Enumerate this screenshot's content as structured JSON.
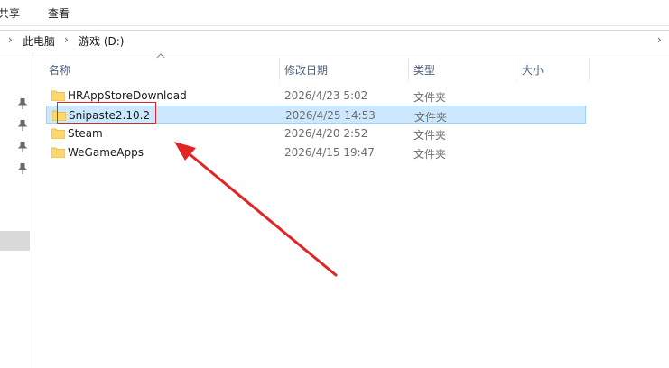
{
  "ribbon": {
    "tabs": [
      "共享",
      "查看"
    ]
  },
  "address": {
    "crumbs": [
      "此电脑",
      "游戏 (D:)"
    ]
  },
  "columns": {
    "name": "名称",
    "modified": "修改日期",
    "type": "类型",
    "size": "大小"
  },
  "files": [
    {
      "name": "HRAppStoreDownload",
      "modified": "2026/4/23 5:02",
      "type": "文件夹",
      "selected": false
    },
    {
      "name": "Snipaste2.10.2",
      "modified": "2026/4/25 14:53",
      "type": "文件夹",
      "selected": true
    },
    {
      "name": "Steam",
      "modified": "2026/4/20 2:52",
      "type": "文件夹",
      "selected": false
    },
    {
      "name": "WeGameApps",
      "modified": "2026/4/15 19:47",
      "type": "文件夹",
      "selected": false
    }
  ],
  "icons": {
    "folder": "folder-icon",
    "pin": "pin-icon",
    "chevron": "chevron-right-icon"
  },
  "colors": {
    "selection": "#cce8ff",
    "annotation": "#e12424",
    "folder": "#ffd86b"
  }
}
